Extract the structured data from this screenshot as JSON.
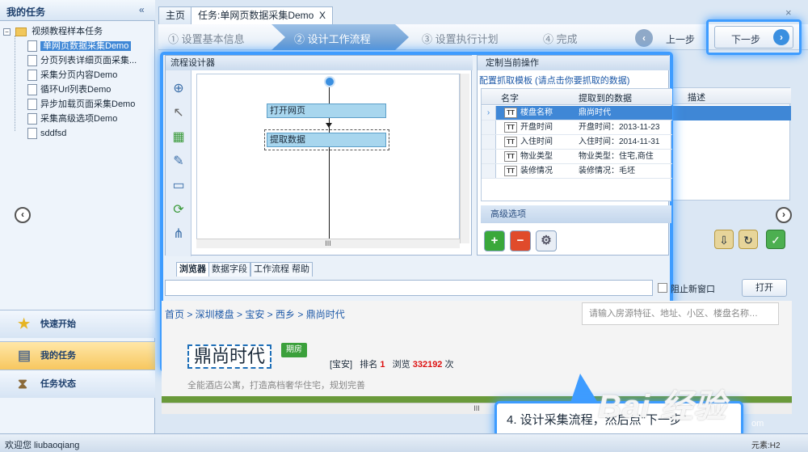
{
  "left_panel": {
    "title": "我的任务",
    "collapse": "«",
    "tree": {
      "root": "视频教程样本任务",
      "items": [
        "单网页数据采集Demo",
        "分页列表详细页面采集...",
        "采集分页内容Demo",
        "循环Url列表Demo",
        "异步加载页面采集Demo",
        "采集高级选项Demo",
        "sddfsd"
      ]
    },
    "nav": [
      "快速开始",
      "我的任务",
      "任务状态"
    ]
  },
  "doc_tabs": [
    "主页",
    "任务:单网页数据采集Demo"
  ],
  "doc_tab_close": "X",
  "window_close": "×",
  "steps": [
    "① 设置基本信息",
    "② 设计工作流程",
    "③ 设置执行计划",
    "④ 完成"
  ],
  "prev_label": "上一步",
  "next_label": "下一步",
  "designer": {
    "title": "流程设计器",
    "nodes": [
      "打开网页",
      "提取数据"
    ],
    "hscroll": "III"
  },
  "op_panel": {
    "title": "定制当前操作",
    "link": "配置抓取模板 (请点击你要抓取的数据)",
    "columns": [
      "名字",
      "提取到的数据",
      "描述"
    ],
    "rows": [
      {
        "type": "TT",
        "name": "楼盘名称",
        "value": "鼎尚时代"
      },
      {
        "type": "TT",
        "name": "开盘时间",
        "value": "开盘时间：2013-11-23"
      },
      {
        "type": "TT",
        "name": "入住时间",
        "value": "入住时间：2014-11-31"
      },
      {
        "type": "TT",
        "name": "物业类型",
        "value": "物业类型：住宅,商住"
      },
      {
        "type": "TT",
        "name": "装修情况",
        "value": "装修情况：毛坯"
      }
    ],
    "advanced": "高级选项"
  },
  "browser_tabs": [
    "浏览器",
    "数据字段",
    "工作流程 帮助"
  ],
  "new_window_label": "阻止新窗口",
  "open_label": "打开",
  "webpage": {
    "breadcrumb": "首页 > 深圳楼盘 > 宝安 > 西乡 > 鼎尚时代",
    "search_placeholder": "请输入房源特征、地址、小区、楼盘名称…",
    "title": "鼎尚时代",
    "tag": "期房",
    "district": "[宝安]",
    "rank_label": "排名",
    "rank": "1",
    "views_label": "浏览",
    "views": "332192",
    "views_unit": "次",
    "slogan": "全能酒店公寓，打造高档奢华住宅，规划完善"
  },
  "callout": "4. 设计采集流程，然后点\"下一步\"",
  "status": "欢迎您 liubaoqiang",
  "version": "元素:H2",
  "watermark": "Bai 经验",
  "watermark_sub": "om",
  "colors": {
    "accent": "#3e9cff",
    "selection": "#3f87d6",
    "node": "#a8d6ee",
    "green": "#3ba03b"
  }
}
